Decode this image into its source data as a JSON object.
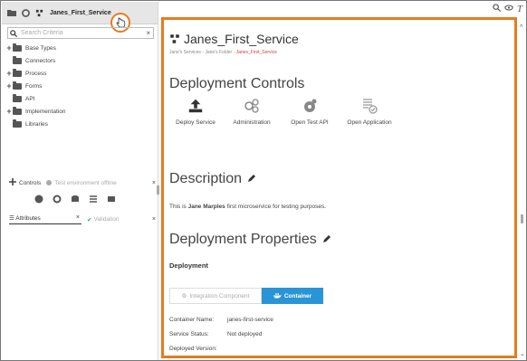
{
  "left_panel": {
    "tab_title": "Janes_First_Service",
    "search_placeholder": "Search Criteria",
    "tree": [
      {
        "label": "Base Types",
        "expandable": true
      },
      {
        "label": "Connectors",
        "expandable": false
      },
      {
        "label": "Process",
        "expandable": true
      },
      {
        "label": "Forms",
        "expandable": true
      },
      {
        "label": "API",
        "expandable": false
      },
      {
        "label": "Implementation",
        "expandable": true
      },
      {
        "label": "Libraries",
        "expandable": false
      }
    ],
    "controls": {
      "label": "Controls",
      "status": "Test environment offline"
    },
    "attributes_tab": "Attributes",
    "validation_tab": "Validation"
  },
  "main": {
    "service_title": "Janes_First_Service",
    "breadcrumb": {
      "part1": "Jane's Services",
      "sep": "-",
      "part2": "Jane's Folder",
      "current": "Janes_First_Service"
    },
    "deployment_controls_heading": "Deployment Controls",
    "controls": [
      {
        "label": "Deploy Service",
        "icon": "upload-icon"
      },
      {
        "label": "Administration",
        "icon": "gears-icon"
      },
      {
        "label": "Open Test API",
        "icon": "test-api-icon"
      },
      {
        "label": "Open Application",
        "icon": "application-icon"
      }
    ],
    "description_heading": "Description",
    "description": {
      "prefix": "This is ",
      "bold": "Jane Marples",
      "suffix": " first microservice for testing purposes."
    },
    "properties_heading": "Deployment Properties",
    "deployment_label": "Deployment",
    "toggle": {
      "integration": "Integration Component",
      "container": "Container",
      "selected": "Container"
    },
    "properties": [
      {
        "label": "Container Name:",
        "value": "janes-first-service"
      },
      {
        "label": "Service Status:",
        "value": "Not deployed"
      },
      {
        "label": "Deployed Version:",
        "value": ""
      }
    ]
  },
  "colors": {
    "accent_orange": "#e87b1e",
    "primary_blue": "#2a95d6",
    "breadcrumb_red": "#d43b3b"
  }
}
